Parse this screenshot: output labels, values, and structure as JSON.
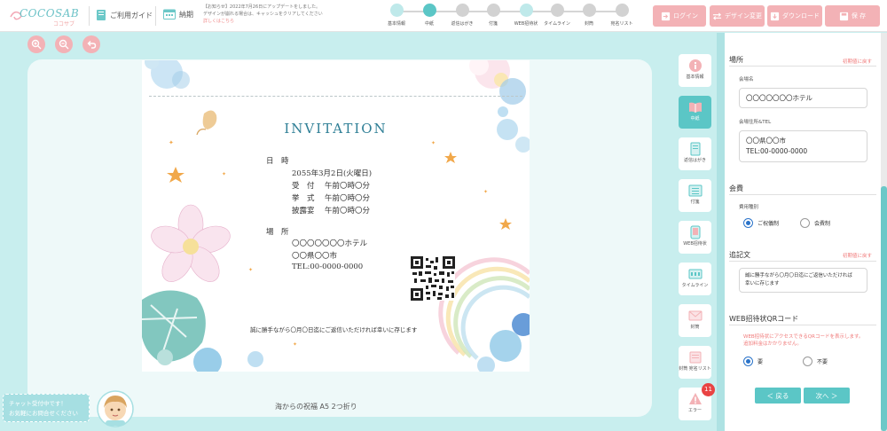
{
  "header": {
    "logo": "COCOSAB",
    "logo_sub": "ココサブ",
    "guide_label": "ご利用ガイド",
    "deadline_label": "納期",
    "notice_line1": "【お知らせ】2022年7月26日にアップデートをしました。",
    "notice_line2": "デザインが崩れる場合は、キャッシュをクリアしてください",
    "notice_link": "詳しくはこちら",
    "buttons": {
      "login": "ログイン",
      "design_change": "デザイン変更",
      "download": "ダウンロード",
      "save": "保 存"
    }
  },
  "steps": [
    {
      "label": "基本情報",
      "state": "done"
    },
    {
      "label": "中紙",
      "state": "current"
    },
    {
      "label": "返信はがき",
      "state": "todo"
    },
    {
      "label": "付箋",
      "state": "todo"
    },
    {
      "label": "WEB招待状",
      "state": "done"
    },
    {
      "label": "タイムライン",
      "state": "todo"
    },
    {
      "label": "封筒",
      "state": "todo"
    },
    {
      "label": "宛名リスト",
      "state": "todo"
    }
  ],
  "tools": [
    "zoom-in",
    "zoom-out",
    "undo"
  ],
  "card": {
    "title": "INVITATION",
    "date_label": "日　時",
    "date_value": "2055年3月2日(火曜日)",
    "times": [
      {
        "label": "受　付",
        "value": "午前〇時〇分"
      },
      {
        "label": "挙　式",
        "value": "午前〇時〇分"
      },
      {
        "label": "披露宴",
        "value": "午前〇時〇分"
      }
    ],
    "place_label": "場　所",
    "place_lines": [
      "〇〇〇〇〇〇〇ホテル",
      "〇〇県〇〇市",
      "TEL:00-0000-0000"
    ],
    "reply_note": "誠に勝手ながら〇月〇日迄にご返信いただければ幸いに存じます",
    "caption": "海からの祝福 A5 2つ折り"
  },
  "chat": {
    "line1": "チャット受付中です！",
    "line2": "お気軽にお問合せください"
  },
  "nav": [
    {
      "label": "基本情報",
      "active": false
    },
    {
      "label": "中紙",
      "active": true
    },
    {
      "label": "返信はがき",
      "active": false
    },
    {
      "label": "付箋",
      "active": false
    },
    {
      "label": "WEB招待状",
      "active": false
    },
    {
      "label": "タイムライン",
      "active": false
    },
    {
      "label": "封筒",
      "active": false
    },
    {
      "label": "封筒 宛名リスト",
      "active": false
    },
    {
      "label": "エラー",
      "active": false
    }
  ],
  "error_count": "11",
  "panel": {
    "place": {
      "title": "場所",
      "reset": "初期値に戻す",
      "venue_label": "会場名",
      "venue_value": "〇〇〇〇〇〇〇ホテル",
      "address_label": "会場住所&TEL",
      "address_line1": "〇〇県〇〇市",
      "address_line2": "TEL:00-0000-0000"
    },
    "fee": {
      "title": "会費",
      "type_label": "費用種別",
      "options": [
        "ご祝儀制",
        "会費制"
      ],
      "selected": "ご祝儀制"
    },
    "note": {
      "title": "追記文",
      "reset": "初期値に戻す",
      "value_line1": "誠に勝手ながら〇月〇日迄にご返信いただければ",
      "value_line2": "幸いに存じます"
    },
    "qr": {
      "title": "WEB招待状QRコード",
      "desc_line1": "WEB招待状にアクセスできるQRコードを表示します。",
      "desc_line2": "追加料金はかかりません。",
      "options": [
        "要",
        "不要"
      ],
      "selected": "要"
    },
    "back": "＜ 戻る",
    "next": "次へ ＞"
  },
  "colors": {
    "teal": "#5bc6c6",
    "pink": "#f3b2b6",
    "error": "#e94343",
    "bg": "#c8eeee"
  }
}
